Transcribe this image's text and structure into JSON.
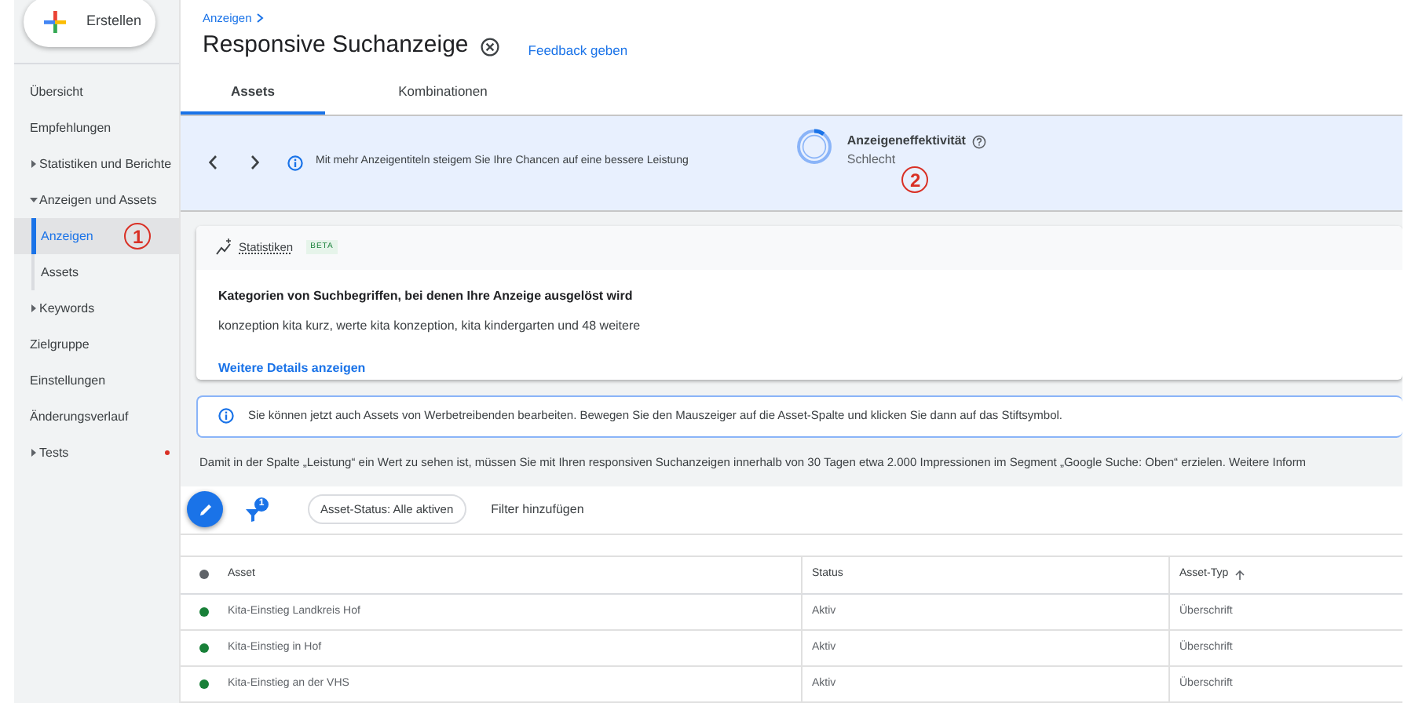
{
  "create_button": {
    "label": "Erstellen"
  },
  "sidebar": {
    "items": [
      {
        "label": "Übersicht",
        "kind": "link",
        "selected": false
      },
      {
        "label": "Empfehlungen",
        "kind": "link",
        "selected": false
      },
      {
        "label": "Statistiken und Berichte",
        "kind": "group",
        "expanded": false,
        "selected": false
      },
      {
        "label": "Anzeigen und Assets",
        "kind": "group",
        "expanded": true,
        "selected": false,
        "children": [
          {
            "label": "Anzeigen",
            "selected": true,
            "annotation": "1"
          },
          {
            "label": "Assets",
            "selected": false
          }
        ]
      },
      {
        "label": "Keywords",
        "kind": "group",
        "expanded": false,
        "selected": false
      },
      {
        "label": "Zielgruppe",
        "kind": "link",
        "selected": false
      },
      {
        "label": "Einstellungen",
        "kind": "link",
        "selected": false
      },
      {
        "label": "Änderungsverlauf",
        "kind": "link",
        "selected": false
      },
      {
        "label": "Tests",
        "kind": "group",
        "expanded": false,
        "selected": false,
        "notification": true
      }
    ]
  },
  "header": {
    "breadcrumb": "Anzeigen",
    "title": "Responsive Suchanzeige",
    "feedback_link": "Feedback geben"
  },
  "tabs": [
    {
      "label": "Assets",
      "selected": true
    },
    {
      "label": "Kombinationen",
      "selected": false
    }
  ],
  "banner": {
    "message": "Mit mehr Anzeigentiteln steigem Sie Ihre Chancen auf eine bessere Leistung",
    "effectiveness": {
      "title": "Anzeigeneffektivität",
      "rating": "Schlecht",
      "level": 0.1,
      "annotation": "2"
    }
  },
  "insights": {
    "title": "Statistiken",
    "badge": "BETA",
    "heading": "Kategorien von Suchbegriffen, bei denen Ihre Anzeige ausgelöst wird",
    "text": "konzeption kita kurz, werte kita konzeption, kita kindergarten und 48 weitere",
    "link": "Weitere Details anzeigen"
  },
  "notice": "Sie können jetzt auch Assets von Werbetreibenden bearbeiten. Bewegen Sie den Mauszeiger auf die Asset-Spalte und klicken Sie dann auf das Stiftsymbol.",
  "performance_note": {
    "text": "Damit in der Spalte „Leistung“ ein Wert zu sehen ist, müssen Sie mit Ihren responsiven Suchanzeigen innerhalb von 30 Tagen etwa 2.000 Impressionen im Segment „Google Suche: Oben“ erzielen.",
    "link": "Weitere Inform"
  },
  "toolbar": {
    "filter_count": "1",
    "chip": "Asset-Status: Alle aktiven",
    "add_filter": "Filter hinzufügen"
  },
  "table": {
    "columns": [
      {
        "label": "Asset",
        "sorted": false
      },
      {
        "label": "Status",
        "sorted": false
      },
      {
        "label": "Asset-Typ",
        "sorted": true
      }
    ],
    "rows": [
      {
        "asset": "Kita-Einstieg Landkreis Hof",
        "status": "Aktiv",
        "asset_type": "Überschrift",
        "color": "#188038"
      },
      {
        "asset": "Kita-Einstieg in Hof",
        "status": "Aktiv",
        "asset_type": "Überschrift",
        "color": "#188038"
      },
      {
        "asset": "Kita-Einstieg an der VHS",
        "status": "Aktiv",
        "asset_type": "Überschrift",
        "color": "#188038"
      }
    ]
  }
}
